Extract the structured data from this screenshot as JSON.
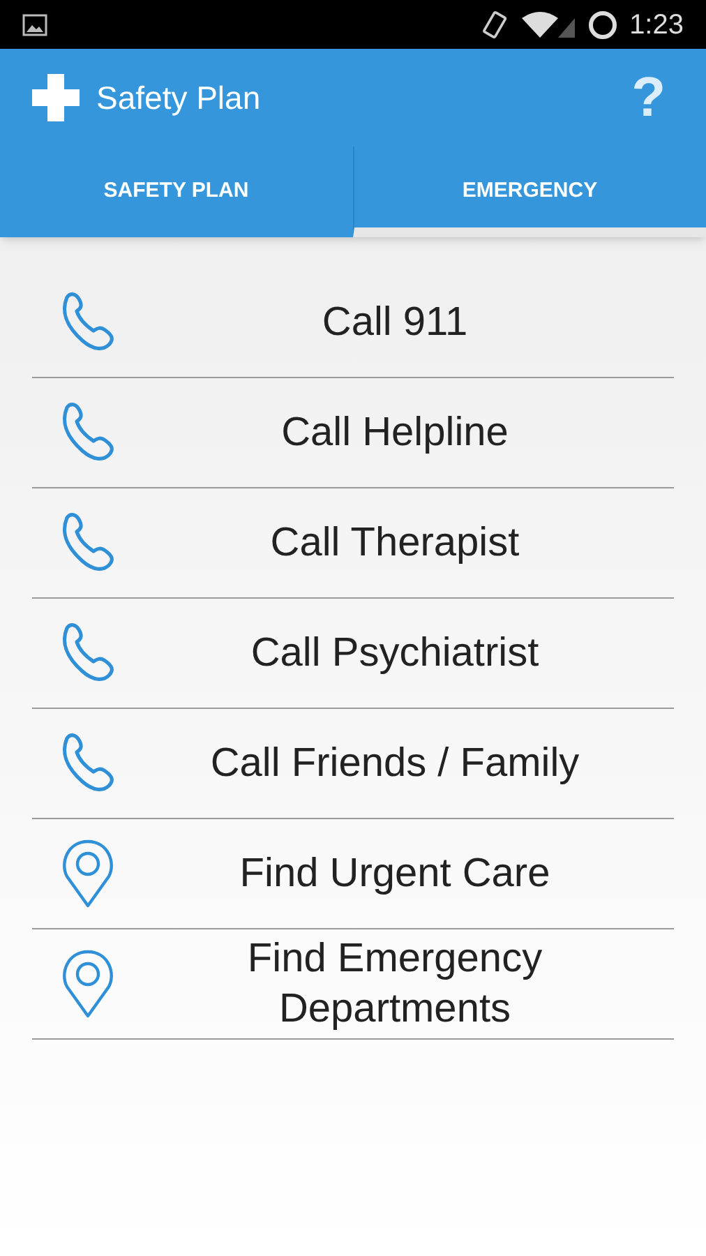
{
  "status_bar": {
    "time": "1:23"
  },
  "app_bar": {
    "title": "Safety Plan",
    "help": "?"
  },
  "tabs": [
    {
      "label": "SAFETY PLAN",
      "selected": false
    },
    {
      "label": "EMERGENCY",
      "selected": true
    }
  ],
  "actions": [
    {
      "kind": "phone",
      "label": "Call 911"
    },
    {
      "kind": "phone",
      "label": "Call Helpline"
    },
    {
      "kind": "phone",
      "label": "Call Therapist"
    },
    {
      "kind": "phone",
      "label": "Call Psychiatrist"
    },
    {
      "kind": "phone",
      "label": "Call Friends / Family"
    },
    {
      "kind": "location",
      "label": "Find Urgent Care"
    },
    {
      "kind": "location",
      "label": "Find Emergency Departments"
    }
  ]
}
